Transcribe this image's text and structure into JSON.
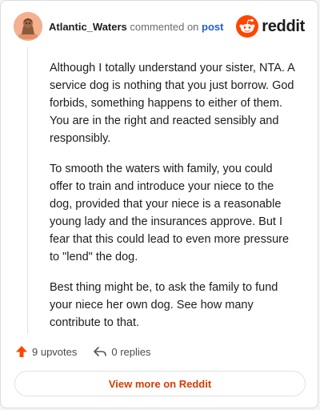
{
  "comment": {
    "username": "Atlantic_Waters",
    "action_text": "commented on",
    "post_link_text": "post",
    "paragraphs": [
      "Although I totally understand your sister, NTA. A service dog is nothing that you just borrow. God forbids, something happens to either of them. You are in the right and reacted sensibly and responsibly.",
      "To smooth the waters with family, you could offer to train and introduce your niece to the dog, provided that your niece is a reasonable young lady and the insurances approve. But I fear that this could lead to even more pressure to \"lend\" the dog.",
      "Best thing might be, to ask the family to fund your niece her own dog. See how many contribute to that."
    ],
    "upvotes": "9 upvotes",
    "replies": "0 replies",
    "view_button": "View more on Reddit"
  },
  "brand": {
    "name": "reddit",
    "icon": "reddit-snoo-icon"
  },
  "icons": {
    "avatar": "avatar-image",
    "upvote": "upvote-arrow-icon",
    "reply": "reply-arrow-icon"
  },
  "colors": {
    "brand_orange": "#ff4500",
    "link_blue": "#1f5ecc",
    "cta_orange": "#d93a00"
  }
}
